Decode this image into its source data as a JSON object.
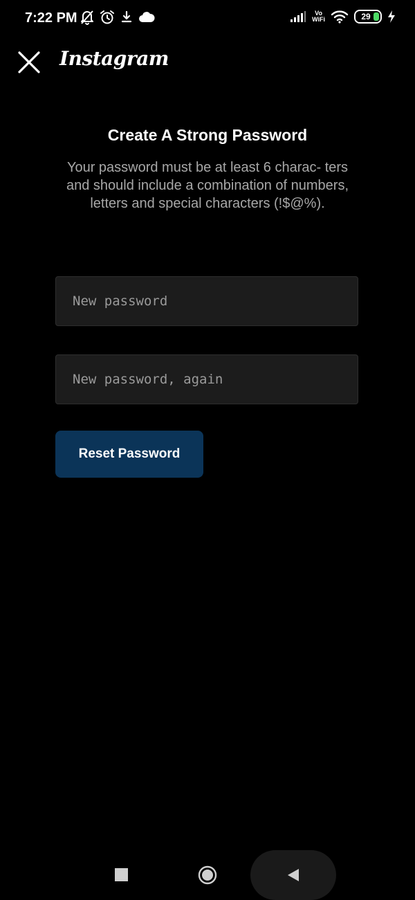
{
  "status_bar": {
    "time": "7:22 PM",
    "left_icons": [
      "bell-off-icon",
      "alarm-icon",
      "download-icon",
      "cloud-icon"
    ],
    "vowifi_top": "Vo",
    "vowifi_bottom": "WiFi",
    "battery_level": "29",
    "right_icons": [
      "signal-icon",
      "vowifi-icon",
      "wifi-icon",
      "battery-icon",
      "charging-icon"
    ],
    "battery_color": "#4cd964"
  },
  "header": {
    "brand": "Instagram",
    "close_icon": "close-icon"
  },
  "content": {
    "title": "Create A Strong Password",
    "description": "Your password must be at least 6 charac- ters and should include a combination of numbers, letters and special characters (!$@%).",
    "new_password_placeholder": "New password",
    "new_password_value": "",
    "confirm_password_placeholder": "New password, again",
    "confirm_password_value": "",
    "reset_button_label": "Reset Password"
  },
  "nav_bar": {
    "icons": [
      "recents-square-icon",
      "home-circle-icon",
      "back-triangle-icon"
    ]
  },
  "colors": {
    "background": "#000000",
    "field_background": "#1c1c1c",
    "button_background": "#0b3458",
    "description_text": "#a8a8a8"
  }
}
